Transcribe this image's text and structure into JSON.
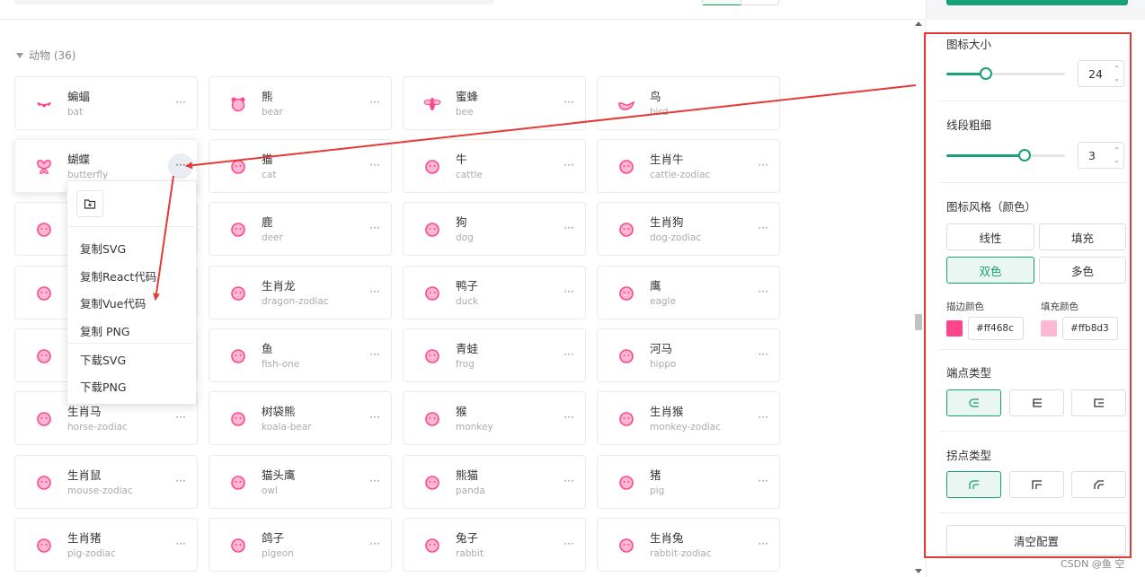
{
  "category": {
    "label": "动物 (36)"
  },
  "colors": {
    "accent": "#18a077",
    "icon": "#ff468c",
    "annotation": "#e53935"
  },
  "icons": [
    {
      "zh": "蝙蝠",
      "en": "bat",
      "icon": "bat-icon"
    },
    {
      "zh": "熊",
      "en": "bear",
      "icon": "bear-icon"
    },
    {
      "zh": "蜜蜂",
      "en": "bee",
      "icon": "bee-icon"
    },
    {
      "zh": "鸟",
      "en": "bird",
      "icon": "bird-icon"
    },
    {
      "zh": "蝴蝶",
      "en": "butterfly",
      "icon": "butterfly-icon"
    },
    {
      "zh": "猫",
      "en": "cat",
      "icon": "cat-icon"
    },
    {
      "zh": "牛",
      "en": "cattle",
      "icon": "cattle-icon"
    },
    {
      "zh": "生肖牛",
      "en": "cattle-zodiac",
      "icon": "cattle-zodiac-icon"
    },
    {
      "zh": "",
      "en": "",
      "icon": "chicken-icon"
    },
    {
      "zh": "鹿",
      "en": "deer",
      "icon": "deer-icon"
    },
    {
      "zh": "狗",
      "en": "dog",
      "icon": "dog-icon"
    },
    {
      "zh": "生肖狗",
      "en": "dog-zodiac",
      "icon": "dog-zodiac-icon"
    },
    {
      "zh": "",
      "en": "",
      "icon": "dolphin-icon"
    },
    {
      "zh": "生肖龙",
      "en": "dragon-zodiac",
      "icon": "dragon-zodiac-icon"
    },
    {
      "zh": "鸭子",
      "en": "duck",
      "icon": "duck-icon"
    },
    {
      "zh": "鹰",
      "en": "eagle",
      "icon": "eagle-icon"
    },
    {
      "zh": "",
      "en": "",
      "icon": "elephant-icon"
    },
    {
      "zh": "鱼",
      "en": "fish-one",
      "icon": "fish-icon"
    },
    {
      "zh": "青蛙",
      "en": "frog",
      "icon": "frog-icon"
    },
    {
      "zh": "河马",
      "en": "hippo",
      "icon": "hippo-icon"
    },
    {
      "zh": "生肖马",
      "en": "horse-zodiac",
      "icon": "horse-zodiac-icon"
    },
    {
      "zh": "树袋熊",
      "en": "koala-bear",
      "icon": "koala-icon"
    },
    {
      "zh": "猴",
      "en": "monkey",
      "icon": "monkey-icon"
    },
    {
      "zh": "生肖猴",
      "en": "monkey-zodiac",
      "icon": "monkey-zodiac-icon"
    },
    {
      "zh": "生肖鼠",
      "en": "mouse-zodiac",
      "icon": "mouse-zodiac-icon"
    },
    {
      "zh": "猫头鹰",
      "en": "owl",
      "icon": "owl-icon"
    },
    {
      "zh": "熊猫",
      "en": "panda",
      "icon": "panda-icon"
    },
    {
      "zh": "猪",
      "en": "pig",
      "icon": "pig-icon"
    },
    {
      "zh": "生肖猪",
      "en": "pig-zodiac",
      "icon": "pig-zodiac-icon"
    },
    {
      "zh": "鸽子",
      "en": "pigeon",
      "icon": "pigeon-icon"
    },
    {
      "zh": "兔子",
      "en": "rabbit",
      "icon": "rabbit-icon"
    },
    {
      "zh": "生肖兔",
      "en": "rabbit-zodiac",
      "icon": "rabbit-zodiac-icon"
    }
  ],
  "more_label": "···",
  "menu": {
    "items": [
      "复制SVG",
      "复制React代码",
      "复制Vue代码",
      "复制 PNG",
      "下载SVG",
      "下载PNG"
    ]
  },
  "sidebar": {
    "size_label": "图标大小",
    "size_value": "24",
    "size_fraction": 0.33,
    "stroke_label": "线段粗细",
    "stroke_value": "3",
    "stroke_fraction": 0.66,
    "style_label": "图标风格（颜色）",
    "styles": [
      "线性",
      "填充",
      "双色",
      "多色"
    ],
    "style_selected": "双色",
    "stroke_color_label": "描边颜色",
    "fill_color_label": "填充颜色",
    "stroke_color": "#ff468c",
    "fill_color": "#ffb8d3",
    "linecap_label": "端点类型",
    "linejoin_label": "拐点类型",
    "clear_label": "清空配置"
  },
  "watermark": "CSDN @鱼 空"
}
